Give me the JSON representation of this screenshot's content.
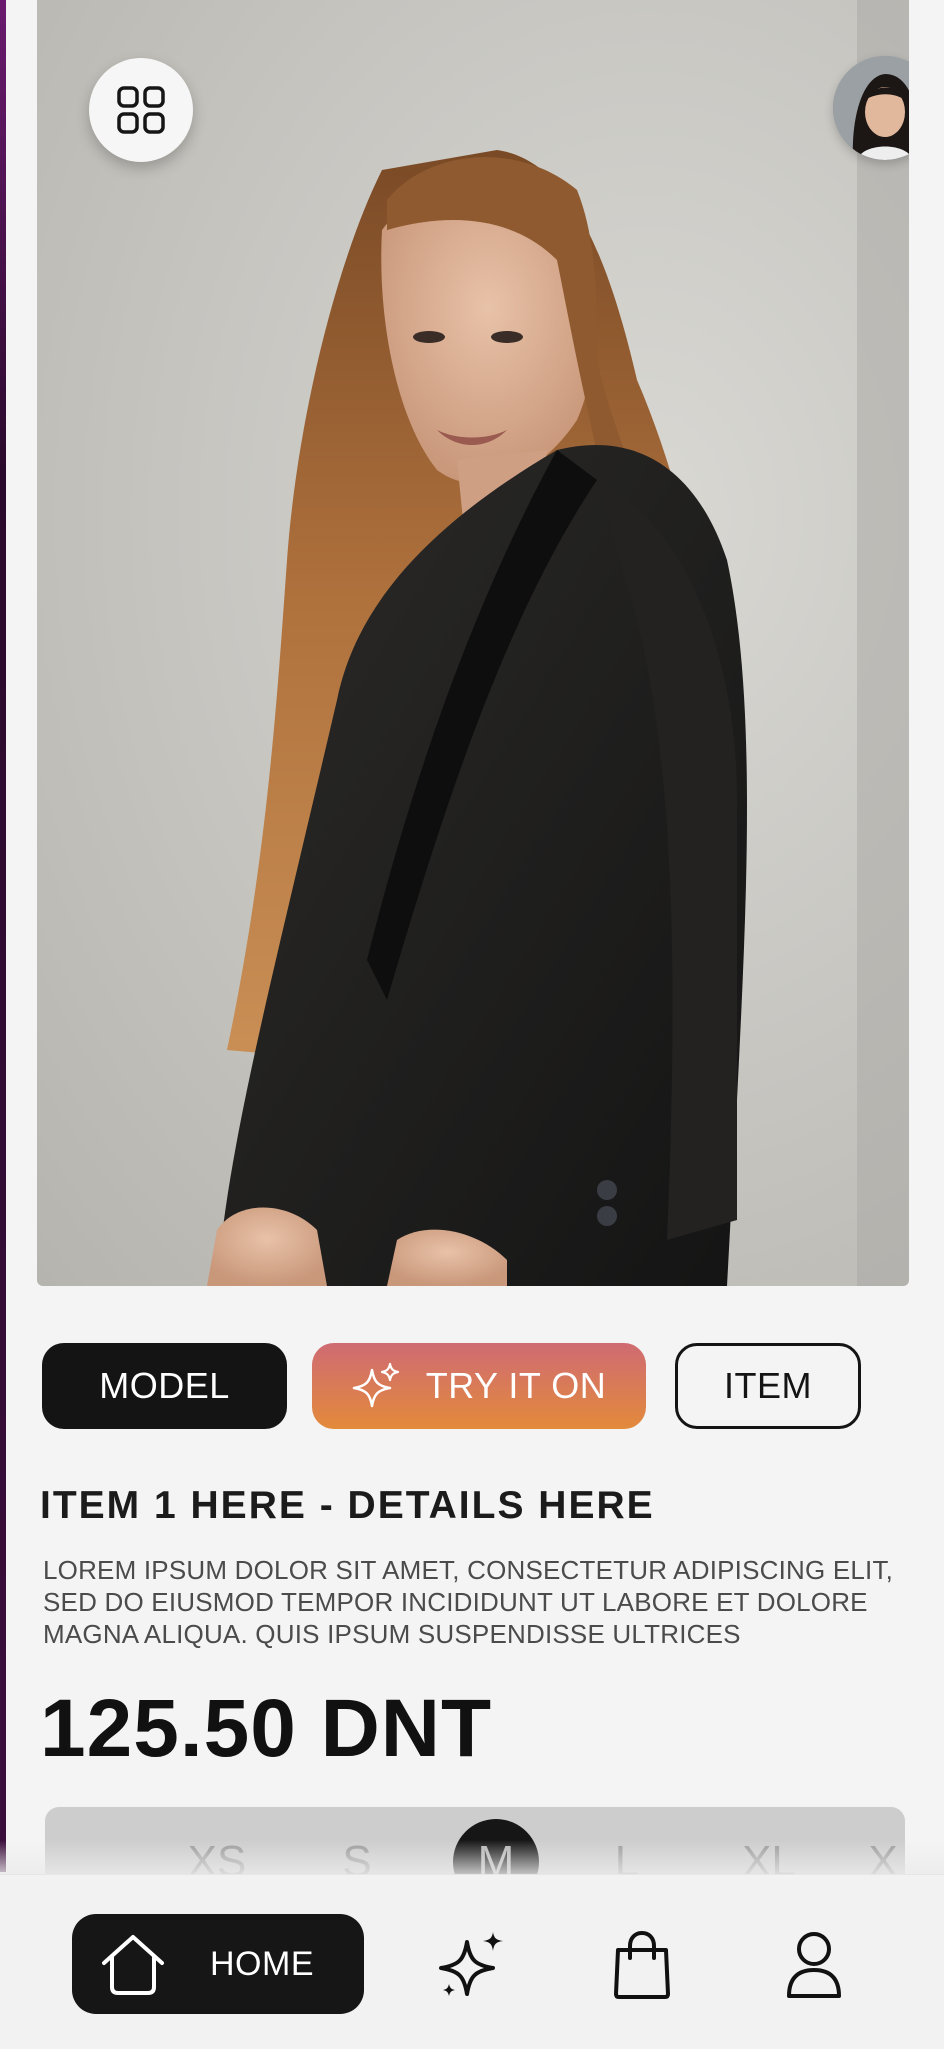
{
  "header": {
    "menu_icon": "grid-icon",
    "avatar_icon": "user-avatar"
  },
  "tabs": {
    "model_label": "MODEL",
    "try_label": "TRY IT ON",
    "try_icon": "sparkles-icon",
    "item_label": "ITEM",
    "active": "MODEL"
  },
  "product": {
    "title": "ITEM 1 HERE - DETAILS HERE",
    "description": "LOREM IPSUM DOLOR SIT AMET, CONSECTETUR ADIPISCING ELIT, SED DO EIUSMOD TEMPOR INCIDIDUNT UT LABORE ET DOLORE MAGNA ALIQUA. QUIS IPSUM SUSPENDISSE ULTRICES",
    "price": "125.50 DNT"
  },
  "sizes": {
    "options": [
      "XS",
      "S",
      "M",
      "L",
      "XL",
      "X"
    ],
    "selected": "M"
  },
  "bottom_nav": {
    "home_label": "HOME",
    "items": [
      "home-icon",
      "sparkles-icon",
      "shopping-bag-icon",
      "profile-icon"
    ]
  },
  "colors": {
    "background": "#f4f4f4",
    "primary_dark": "#141414",
    "gradient_start": "#cf6b73",
    "gradient_end": "#e38a3b"
  }
}
